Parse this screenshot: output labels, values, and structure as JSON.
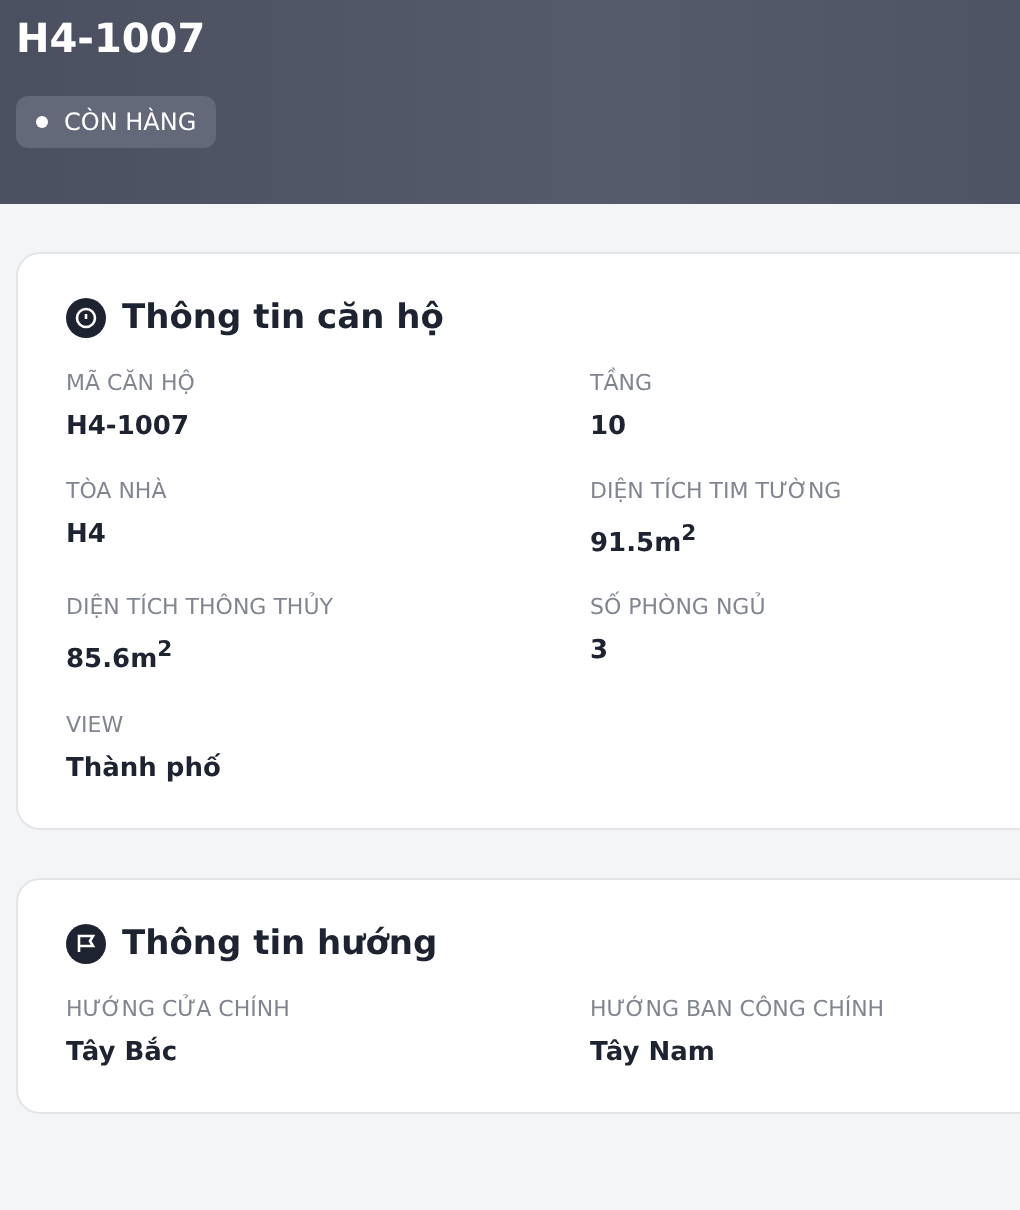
{
  "header": {
    "title": "H4-1007",
    "status_badge": "CÒN HÀNG"
  },
  "sections": [
    {
      "title": "Thông tin căn hộ",
      "kind": "info",
      "fields": [
        {
          "label": "MÃ CĂN HỘ",
          "value": "H4-1007"
        },
        {
          "label": "TẦNG",
          "value": "10"
        },
        {
          "label": "TÒA NHÀ",
          "value": "H4"
        },
        {
          "label": "DIỆN TÍCH TIM TƯỜNG",
          "value": "91.5m$^{2}$"
        },
        {
          "label": "DIỆN TÍCH THÔNG THỦY",
          "value": "85.6m$^{2}$"
        },
        {
          "label": "SỐ PHÒNG NGỦ",
          "value": "3"
        },
        {
          "label": "VIEW",
          "value": "Thành phố"
        }
      ]
    },
    {
      "title": "Thông tin hướng",
      "kind": "direction",
      "fields": [
        {
          "label": "HƯỚNG CỬA CHÍNH",
          "value": "Tây Bắc"
        },
        {
          "label": "HƯỚNG BAN CÔNG CHÍNH",
          "value": "Tây Nam"
        }
      ]
    }
  ]
}
